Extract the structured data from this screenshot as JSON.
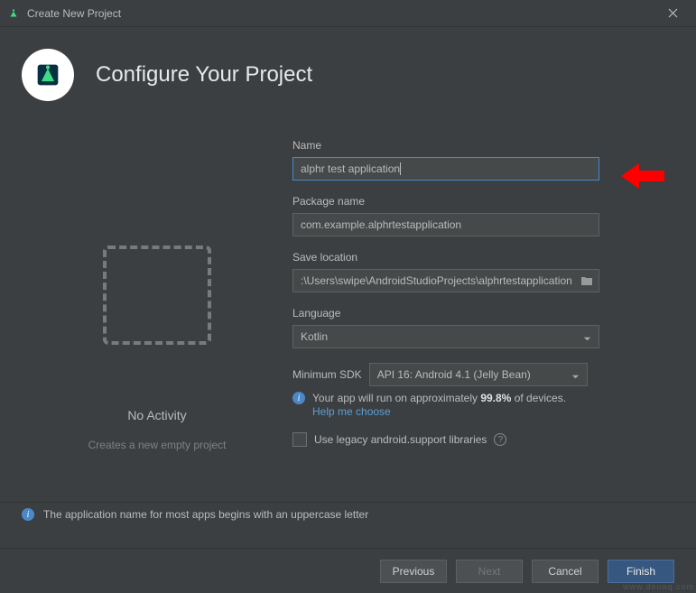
{
  "window": {
    "title": "Create New Project"
  },
  "header": {
    "title": "Configure Your Project"
  },
  "left": {
    "activity_title": "No Activity",
    "activity_sub": "Creates a new empty project"
  },
  "form": {
    "name_label": "Name",
    "name_value": "alphr test application",
    "package_label": "Package name",
    "package_value": "com.example.alphrtestapplication",
    "save_label": "Save location",
    "save_value": ":\\Users\\swipe\\AndroidStudioProjects\\alphrtestapplication",
    "language_label": "Language",
    "language_value": "Kotlin",
    "minsdk_label": "Minimum SDK",
    "minsdk_value": "API 16: Android 4.1 (Jelly Bean)",
    "info_prefix": "Your app will run on approximately ",
    "info_percent": "99.8%",
    "info_suffix": " of devices.",
    "help_link": "Help me choose",
    "checkbox_label": "Use legacy android.support libraries"
  },
  "hint": {
    "text": "The application name for most apps begins with an uppercase letter"
  },
  "footer": {
    "previous": "Previous",
    "next": "Next",
    "cancel": "Cancel",
    "finish": "Finish"
  },
  "watermark": "www.deuaq.com"
}
